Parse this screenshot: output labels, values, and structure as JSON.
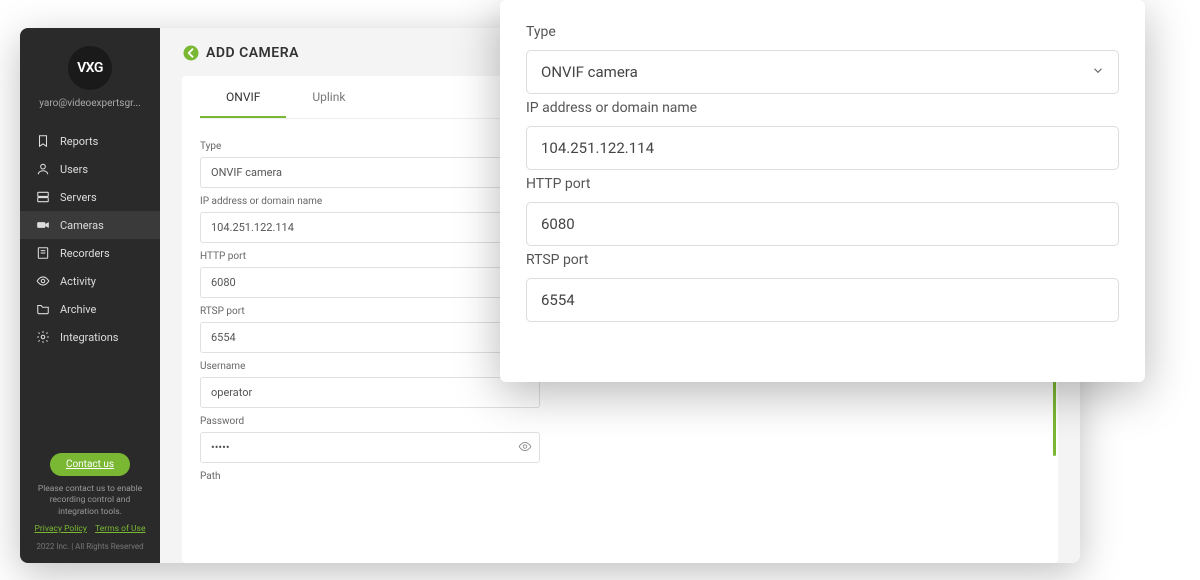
{
  "brand": {
    "logo_text": "VXG"
  },
  "user": {
    "email": "yaro@videoexpertsgr..."
  },
  "sidebar": {
    "items": [
      {
        "label": "Reports",
        "icon": "bookmark-icon"
      },
      {
        "label": "Users",
        "icon": "user-icon"
      },
      {
        "label": "Servers",
        "icon": "server-icon"
      },
      {
        "label": "Cameras",
        "icon": "camera-icon",
        "active": true
      },
      {
        "label": "Recorders",
        "icon": "recorder-icon"
      },
      {
        "label": "Activity",
        "icon": "eye-icon"
      },
      {
        "label": "Archive",
        "icon": "folder-icon"
      },
      {
        "label": "Integrations",
        "icon": "gear-icon"
      }
    ],
    "contact_label": "Contact us",
    "foot_note": "Please contact us to enable recording control and integration tools.",
    "links": {
      "privacy": "Privacy Policy",
      "terms": "Terms of Use"
    },
    "copyright": "2022 Inc. | All Rights Reserved"
  },
  "page": {
    "title": "ADD CAMERA",
    "tabs": [
      {
        "label": "ONVIF",
        "active": true
      },
      {
        "label": "Uplink"
      }
    ]
  },
  "form": {
    "type_label": "Type",
    "type_value": "ONVIF camera",
    "ip_label": "IP address or domain name",
    "ip_value": "104.251.122.114",
    "http_label": "HTTP port",
    "http_value": "6080",
    "rtsp_label": "RTSP port",
    "rtsp_value": "6554",
    "user_label": "Username",
    "user_value": "operator",
    "pass_label": "Password",
    "pass_value": "•••••",
    "path_label": "Path"
  },
  "overlay": {
    "type_label": "Type",
    "type_value": "ONVIF camera",
    "ip_label": "IP address or domain name",
    "ip_value": "104.251.122.114",
    "http_label": "HTTP port",
    "http_value": "6080",
    "rtsp_label": "RTSP port",
    "rtsp_value": "6554"
  }
}
